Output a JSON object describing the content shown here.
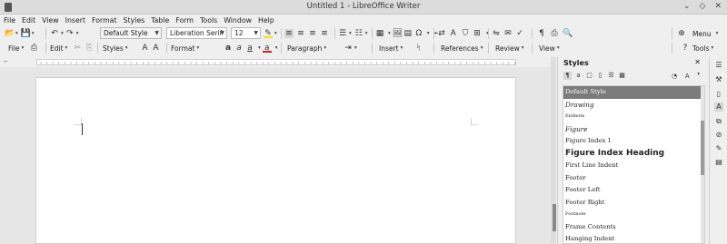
{
  "window": {
    "title": "Untitled 1 - LibreOffice Writer",
    "app_icon": "libreoffice-icon",
    "controls": [
      "minimize-icon",
      "maximize-icon",
      "close-icon"
    ]
  },
  "menu": [
    "File",
    "Edit",
    "View",
    "Insert",
    "Format",
    "Styles",
    "Table",
    "Form",
    "Tools",
    "Window",
    "Help"
  ],
  "toolbar1": {
    "paragraph_style": "Default Style",
    "font_name": "Liberation Serif",
    "font_size": "12",
    "menu_label": "Menu"
  },
  "toolbar2": {
    "file": "File",
    "edit": "Edit",
    "styles": "Styles",
    "format": "Format",
    "paragraph": "Paragraph",
    "insert": "Insert",
    "references": "References",
    "review": "Review",
    "view": "View",
    "tools": "Tools"
  },
  "styles_panel": {
    "title": "Styles",
    "items": [
      {
        "label": "Default Style",
        "selected": true
      },
      {
        "label": "Drawing"
      },
      {
        "label": "Endnote"
      },
      {
        "label": "Figure"
      },
      {
        "label": "Figure Index 1"
      },
      {
        "label": "Figure Index Heading"
      },
      {
        "label": "First Line Indent"
      },
      {
        "label": "Footer"
      },
      {
        "label": "Footer Left"
      },
      {
        "label": "Footer Right"
      },
      {
        "label": "Footnote"
      },
      {
        "label": "Frame Contents"
      },
      {
        "label": "Hanging Indent"
      }
    ]
  },
  "colors": {
    "selected_item_bg": "#7b7b7b",
    "highlight": "#f5e400",
    "font_color": "#d42020"
  }
}
